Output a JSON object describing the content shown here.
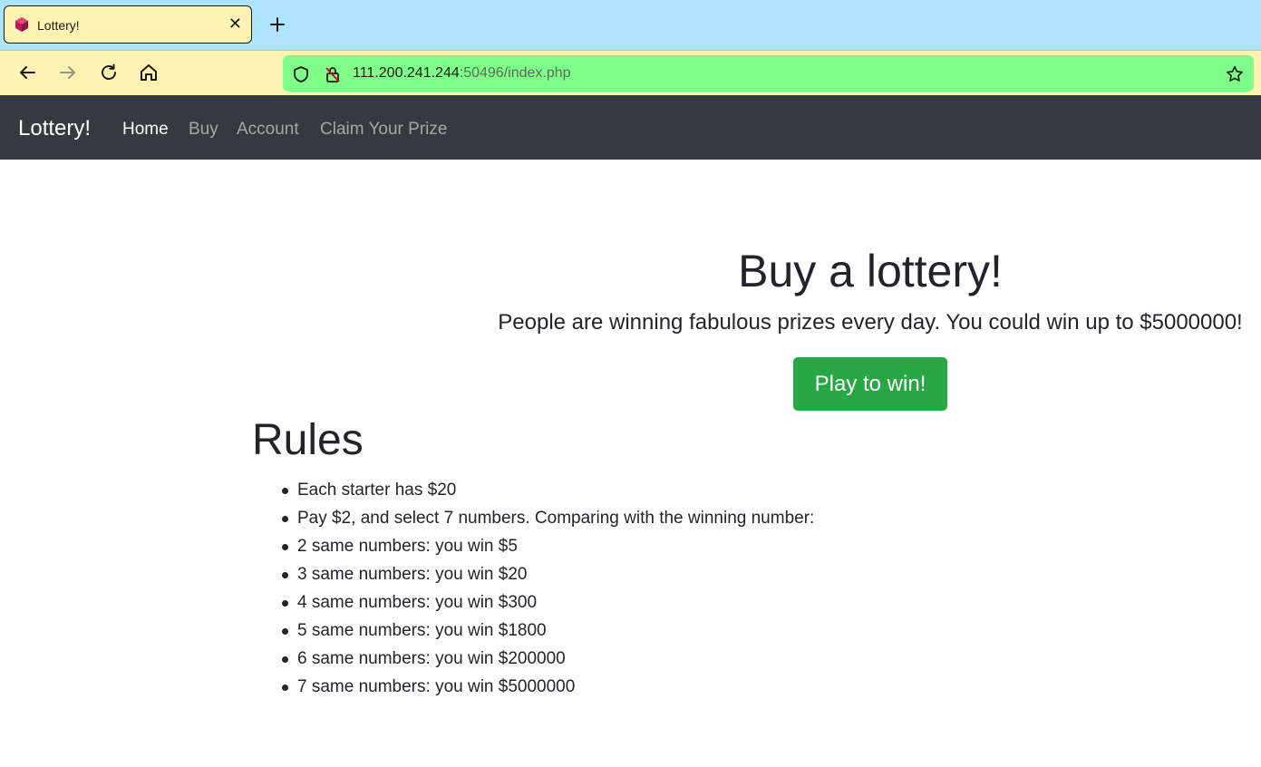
{
  "browser": {
    "tab": {
      "title": "Lottery!",
      "close_glyph": "✕"
    },
    "url": {
      "host": "111.200.241.244",
      "rest": ":50496/index.php"
    },
    "icons": {
      "favicon": "hexagon-favicon-icon",
      "new_tab": "plus-icon",
      "back": "arrow-left-icon",
      "forward": "arrow-right-icon",
      "reload": "reload-icon",
      "home": "home-icon",
      "shield": "shield-icon",
      "lock": "lock-slash-icon",
      "bookmark": "star-icon"
    },
    "colors": {
      "tabstrip": "#aee4fd",
      "toolbar": "#fff3b3",
      "urlbar": "#7fff87"
    }
  },
  "navbar": {
    "brand": "Lottery!",
    "items": [
      {
        "label": "Home",
        "active": true
      },
      {
        "label": "Buy",
        "active": false
      },
      {
        "label": "Account",
        "active": false
      },
      {
        "label": "Claim Your Prize",
        "active": false
      }
    ]
  },
  "hero": {
    "title": "Buy a lottery!",
    "lead": "People are winning fabulous prizes every day. You could win up to $5000000!",
    "button": "Play to win!"
  },
  "rules": {
    "title": "Rules",
    "items": [
      "Each starter has $20",
      "Pay $2, and select 7 numbers. Comparing with the winning number:",
      "2 same numbers: you win $5",
      "3 same numbers: you win $20",
      "4 same numbers: you win $300",
      "5 same numbers: you win $1800",
      "6 same numbers: you win $200000",
      "7 same numbers: you win $5000000"
    ]
  },
  "colors": {
    "navbar": "#343a40",
    "primary_button": "#28a745",
    "text": "#212529"
  }
}
